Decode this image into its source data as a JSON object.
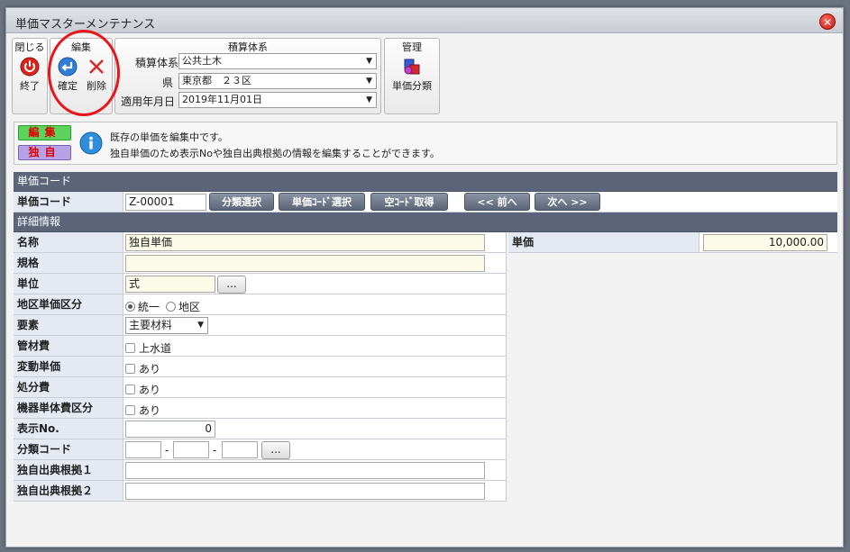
{
  "window": {
    "title": "単価マスターメンテナンス",
    "close_icon": "close-icon"
  },
  "toolbar": {
    "close_group": {
      "title": "閉じる",
      "exit_label": "終了"
    },
    "edit_group": {
      "title": "編集",
      "confirm_label": "確定",
      "delete_label": "削除"
    },
    "system_group": {
      "title": "積算体系",
      "system_label": "積算体系",
      "system_value": "公共土木",
      "pref_label": "県",
      "pref_value": "東京都　２３区",
      "date_label": "適用年月日",
      "date_value": "2019年11月01日"
    },
    "manage_group": {
      "title": "管理",
      "category_label": "単価分類"
    }
  },
  "info": {
    "badge_edit": "編集",
    "badge_own": "独自",
    "line1": "既存の単価を編集中です。",
    "line2": "独自単価のため表示Noや独自出典根拠の情報を編集することができます。"
  },
  "code_section": {
    "header": "単価コード",
    "label": "単価コード",
    "value": "Z-00001",
    "buttons": [
      "分類選択",
      "単価ｺｰﾄﾞ選択",
      "空ｺｰﾄﾞ取得",
      "<< 前へ",
      "次へ >>"
    ]
  },
  "detail_section": {
    "header": "詳細情報",
    "name_label": "名称",
    "name_value": "独自単価",
    "spec_label": "規格",
    "spec_value": "",
    "unit_label": "単位",
    "unit_value": "式",
    "unit_btn": "...",
    "region_label": "地区単価区分",
    "region_opt1": "統一",
    "region_opt2": "地区",
    "element_label": "要素",
    "element_value": "主要材料",
    "pipe_label": "管材費",
    "pipe_opt": "上水道",
    "variable_label": "変動単価",
    "variable_opt": "あり",
    "disposal_label": "処分費",
    "disposal_opt": "あり",
    "equip_label": "機器単体費区分",
    "equip_opt": "あり",
    "display_no_label": "表示No.",
    "display_no_value": "0",
    "class_code_label": "分類コード",
    "class_code_btn": "...",
    "class_code_sep": "-",
    "source1_label": "独自出典根拠１",
    "source1_value": "",
    "source2_label": "独自出典根拠２",
    "source2_value": "",
    "price_label": "単価",
    "price_value": "10,000.00"
  },
  "colors": {
    "header_bg": "#5b6478",
    "label_bg": "#e4e9f2",
    "highlight_circle": "#e8151b"
  }
}
